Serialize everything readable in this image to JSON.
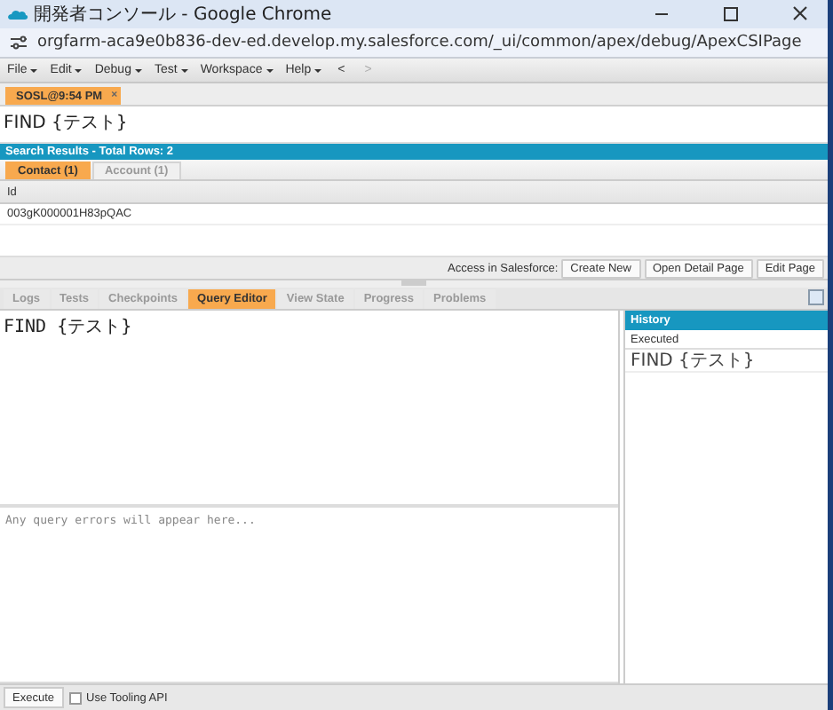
{
  "window": {
    "title": "開発者コンソール - Google Chrome",
    "url": "orgfarm-aca9e0b836-dev-ed.develop.my.salesforce.com/_ui/common/apex/debug/ApexCSIPage"
  },
  "menu": [
    {
      "label": "File"
    },
    {
      "label": "Edit"
    },
    {
      "label": "Debug"
    },
    {
      "label": "Test"
    },
    {
      "label": "Workspace"
    },
    {
      "label": "Help"
    }
  ],
  "nav": [
    {
      "label": "<",
      "disabled": false
    },
    {
      "label": ">",
      "disabled": true
    }
  ],
  "editor_tabs": [
    {
      "label": "SOSL@9:54 PM",
      "selected": true,
      "close": "×"
    }
  ],
  "query": "FIND {テスト}",
  "results": {
    "title": "Search Results - Total Rows: 2",
    "tabs": [
      {
        "label": "Contact (1)",
        "selected": true
      },
      {
        "label": "Account (1)",
        "selected": false
      }
    ],
    "columns": [
      "Id"
    ],
    "rows": [
      [
        "003gK000001H83pQAC"
      ]
    ]
  },
  "actions": {
    "label": "Access in Salesforce:",
    "buttons": [
      "Create New",
      "Open Detail Page",
      "Edit Page"
    ]
  },
  "panel_tabs": [
    {
      "label": "Logs",
      "selected": false
    },
    {
      "label": "Tests",
      "selected": false
    },
    {
      "label": "Checkpoints",
      "selected": false
    },
    {
      "label": "Query Editor",
      "selected": true
    },
    {
      "label": "View State",
      "selected": false
    },
    {
      "label": "Progress",
      "selected": false
    },
    {
      "label": "Problems",
      "selected": false
    }
  ],
  "query_editor": {
    "value": "FIND {テスト}",
    "errors": {
      "placeholder": "Any query errors will appear here..."
    }
  },
  "history": {
    "title": "History",
    "columns": [
      "Executed"
    ],
    "rows": [
      "FIND {テスト}"
    ]
  },
  "footer": {
    "execute": "Execute",
    "tooling": {
      "label": "Use Tooling API",
      "checked": false
    }
  }
}
